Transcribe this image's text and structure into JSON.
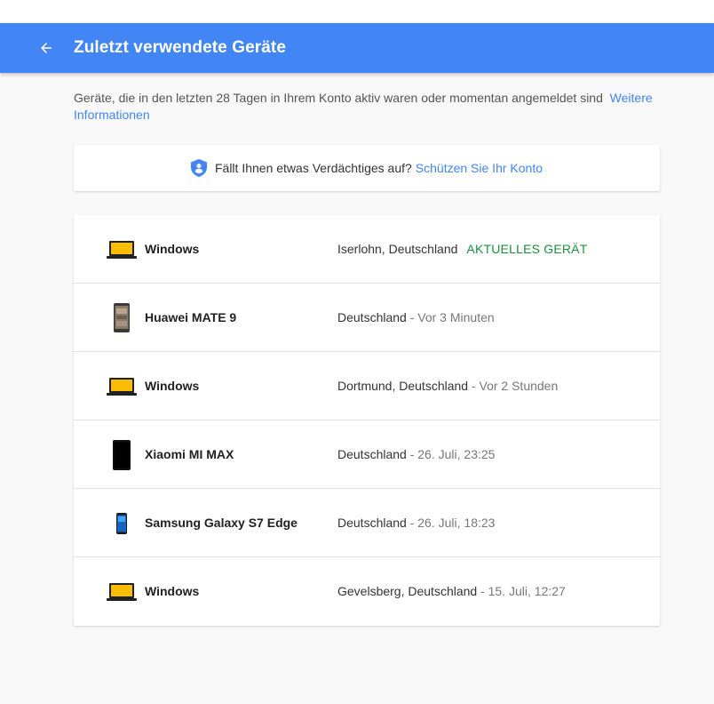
{
  "header": {
    "title": "Zuletzt verwendete Geräte",
    "back_icon": "arrow-back-icon"
  },
  "intro": {
    "text": "Geräte, die in den letzten 28 Tagen in Ihrem Konto aktiv waren oder momentan angemeldet sind",
    "link": "Weitere Informationen"
  },
  "alert": {
    "icon": "shield-person-icon",
    "text": "Fällt Ihnen etwas Verdächtiges auf?",
    "link": "Schützen Sie Ihr Konto"
  },
  "devices": [
    {
      "icon": "laptop-icon",
      "name": "Windows",
      "location": "Iserlohn, Deutschland",
      "time": "",
      "badge": "AKTUELLES GERÄT"
    },
    {
      "icon": "phone-icon",
      "name": "Huawei MATE 9",
      "location": "Deutschland",
      "time": " - Vor 3 Minuten",
      "badge": ""
    },
    {
      "icon": "laptop-icon",
      "name": "Windows",
      "location": "Dortmund, Deutschland",
      "time": " - Vor 2 Stunden",
      "badge": ""
    },
    {
      "icon": "phone-icon",
      "name": "Xiaomi MI MAX",
      "location": "Deutschland",
      "time": " - 26. Juli, 23:25",
      "badge": ""
    },
    {
      "icon": "phone-icon",
      "name": "Samsung Galaxy S7 Edge",
      "location": "Deutschland",
      "time": " - 26. Juli, 18:23",
      "badge": ""
    },
    {
      "icon": "laptop-icon",
      "name": "Windows",
      "location": "Gevelsberg, Deutschland",
      "time": " - 15. Juli, 12:27",
      "badge": ""
    }
  ],
  "colors": {
    "accent": "#4285f4",
    "current_device": "#1e8e3e"
  }
}
